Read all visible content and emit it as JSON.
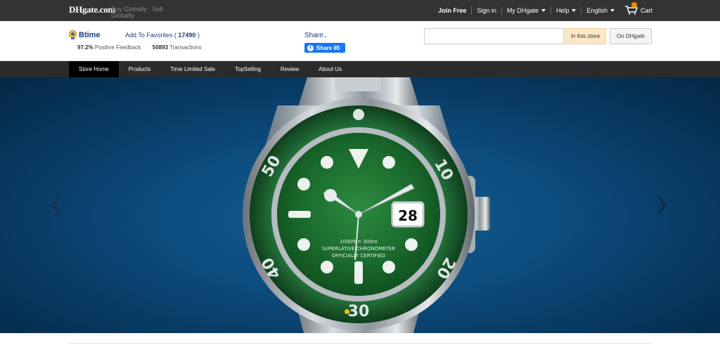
{
  "topbar": {
    "logo": "DHgate.com",
    "tagline": "Buy Globally · Sell Globally",
    "nav": {
      "join_free": "Join Free",
      "sign_in": "Sign in",
      "my_dhgate": "My DHgate",
      "help": "Help",
      "language": "English",
      "cart": "Cart"
    }
  },
  "store": {
    "name": "Btime",
    "favorites_label": "Add To Favorites (",
    "favorites_count": "17490",
    "favorites_close": ")",
    "feedback_percent": "97.2%",
    "feedback_label": "Positive Feedback",
    "transactions_count": "50893",
    "transactions_label": "Transactions",
    "share_label": "Share",
    "fb_share_label": "Share",
    "fb_share_count": "85"
  },
  "search": {
    "placeholder": "",
    "in_store_label": "In this store",
    "on_dhgate_label": "On DHgate"
  },
  "store_nav": {
    "items": [
      {
        "label": "Store Home"
      },
      {
        "label": "Products"
      },
      {
        "label": "Time Limited Sale"
      },
      {
        "label": "TopSelling"
      },
      {
        "label": "Review"
      },
      {
        "label": "About Us"
      }
    ]
  },
  "banner": {
    "watch_date": "28",
    "dial_text_1": "1000ft = 300m",
    "dial_text_2": "SUPERLATIVE CHRONOMETER",
    "dial_text_3": "OFFICIALLY CERTIFIED",
    "bezel_numbers": [
      "10",
      "20",
      "30",
      "40",
      "50"
    ],
    "colors": {
      "background": "#0c4b7d",
      "dial": "#1d6b2e",
      "bezel": "#1e5a2c"
    }
  }
}
